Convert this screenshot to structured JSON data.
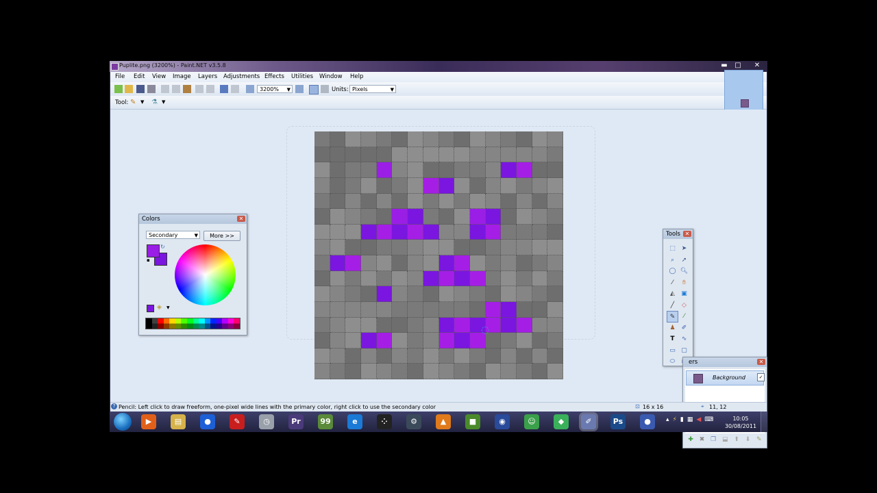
{
  "window": {
    "title": "Puplite.png (3200%) - Paint.NET v3.5.8",
    "controls": {
      "minimize": "▬",
      "maximize": "□",
      "close": "✕"
    }
  },
  "menu": [
    "File",
    "Edit",
    "View",
    "Image",
    "Layers",
    "Adjustments",
    "Effects",
    "Utilities",
    "Window",
    "Help"
  ],
  "toolbar": {
    "zoom_value": "3200%",
    "units_label": "Units:",
    "units_value": "Pixels",
    "tool_label": "Tool:"
  },
  "colors_window": {
    "title": "Colors",
    "mode": "Secondary",
    "more_button": "More >>",
    "primary_color": "#9a1ee6",
    "secondary_color": "#7a16e0",
    "palette": [
      "#000000",
      "#404040",
      "#ff0000",
      "#ff6a00",
      "#ffd800",
      "#b6ff00",
      "#4cff00",
      "#00ff21",
      "#00ff90",
      "#00ffff",
      "#0094ff",
      "#0026ff",
      "#4800ff",
      "#b200ff",
      "#ff00dc",
      "#ff006e"
    ]
  },
  "tools_window": {
    "title": "Tools"
  },
  "layers_window": {
    "title": "ers",
    "layers": [
      {
        "name": "Background",
        "checked": "✓"
      }
    ]
  },
  "canvas": {
    "size": 16,
    "base_colors": [
      "#7a7a7a",
      "#858585",
      "#8e8e8e",
      "#6e6e6e"
    ],
    "purple_pixels": [
      {
        "c": 4,
        "r": 2,
        "color": "#9a1ee6"
      },
      {
        "c": 12,
        "r": 2,
        "color": "#7a16e0"
      },
      {
        "c": 13,
        "r": 2,
        "color": "#a51ee6"
      },
      {
        "c": 7,
        "r": 3,
        "color": "#a51ee6"
      },
      {
        "c": 8,
        "r": 3,
        "color": "#7a16e0"
      },
      {
        "c": 5,
        "r": 5,
        "color": "#9a1ee6"
      },
      {
        "c": 6,
        "r": 5,
        "color": "#7a16e0"
      },
      {
        "c": 10,
        "r": 5,
        "color": "#9a1ee6"
      },
      {
        "c": 11,
        "r": 5,
        "color": "#7a16e0"
      },
      {
        "c": 3,
        "r": 6,
        "color": "#7a16e0"
      },
      {
        "c": 4,
        "r": 6,
        "color": "#a51ee6"
      },
      {
        "c": 5,
        "r": 6,
        "color": "#7a16e0"
      },
      {
        "c": 6,
        "r": 6,
        "color": "#a51ee6"
      },
      {
        "c": 7,
        "r": 6,
        "color": "#7a16e0"
      },
      {
        "c": 10,
        "r": 6,
        "color": "#7a16e0"
      },
      {
        "c": 11,
        "r": 6,
        "color": "#a51ee6"
      },
      {
        "c": 1,
        "r": 8,
        "color": "#7a16e0"
      },
      {
        "c": 2,
        "r": 8,
        "color": "#a51ee6"
      },
      {
        "c": 8,
        "r": 8,
        "color": "#7a16e0"
      },
      {
        "c": 9,
        "r": 8,
        "color": "#a51ee6"
      },
      {
        "c": 7,
        "r": 9,
        "color": "#7a16e0"
      },
      {
        "c": 8,
        "r": 9,
        "color": "#a51ee6"
      },
      {
        "c": 9,
        "r": 9,
        "color": "#7a16e0"
      },
      {
        "c": 10,
        "r": 9,
        "color": "#a51ee6"
      },
      {
        "c": 4,
        "r": 10,
        "color": "#7a16e0"
      },
      {
        "c": 11,
        "r": 11,
        "color": "#a51ee6"
      },
      {
        "c": 12,
        "r": 11,
        "color": "#7a16e0"
      },
      {
        "c": 8,
        "r": 12,
        "color": "#7a16e0"
      },
      {
        "c": 9,
        "r": 12,
        "color": "#a51ee6"
      },
      {
        "c": 10,
        "r": 12,
        "color": "#7a16e0"
      },
      {
        "c": 11,
        "r": 12,
        "color": "#a51ee6"
      },
      {
        "c": 12,
        "r": 12,
        "color": "#7a16e0"
      },
      {
        "c": 13,
        "r": 12,
        "color": "#a51ee6"
      },
      {
        "c": 3,
        "r": 13,
        "color": "#7a16e0"
      },
      {
        "c": 4,
        "r": 13,
        "color": "#a51ee6"
      },
      {
        "c": 8,
        "r": 13,
        "color": "#a51ee6"
      },
      {
        "c": 9,
        "r": 13,
        "color": "#7a16e0"
      },
      {
        "c": 10,
        "r": 13,
        "color": "#a51ee6"
      }
    ]
  },
  "status": {
    "hint": "Pencil: Left click to draw freeform, one-pixel wide lines with the primary color, right click to use the secondary color",
    "image_size": "16 x 16",
    "cursor_pos": "11, 12"
  },
  "taskbar": {
    "time": "10:05",
    "date": "30/08/2011",
    "icons": [
      {
        "name": "media-player-icon",
        "glyph": "▶",
        "color": "#e0601a"
      },
      {
        "name": "file-explorer-icon",
        "glyph": "▤",
        "color": "#d6b24a"
      },
      {
        "name": "app-blue-icon",
        "glyph": "●",
        "color": "#1d5fd6"
      },
      {
        "name": "pin-icon",
        "glyph": "✎",
        "color": "#c81e1e"
      },
      {
        "name": "clock-icon",
        "glyph": "◷",
        "color": "#9aa0aa"
      },
      {
        "name": "premiere-icon",
        "glyph": "Pr",
        "color": "#4a3a7a"
      },
      {
        "name": "app-99-icon",
        "glyph": "99",
        "color": "#5a8a3a"
      },
      {
        "name": "internet-explorer-icon",
        "glyph": "e",
        "color": "#1a7ad6"
      },
      {
        "name": "blackberry-icon",
        "glyph": "⁘",
        "color": "#222222"
      },
      {
        "name": "steam-icon",
        "glyph": "⚙",
        "color": "#3a4a5a"
      },
      {
        "name": "vlc-icon",
        "glyph": "▲",
        "color": "#e07a1a"
      },
      {
        "name": "minecraft-icon",
        "glyph": "■",
        "color": "#4a8a2a"
      },
      {
        "name": "globe-icon",
        "glyph": "◉",
        "color": "#2a4a9a"
      },
      {
        "name": "people-icon",
        "glyph": "☺",
        "color": "#3aa04a"
      },
      {
        "name": "sims-icon",
        "glyph": "◆",
        "color": "#3ab05a"
      },
      {
        "name": "paintnet-icon",
        "glyph": "✐",
        "color": "#6a7ab0"
      },
      {
        "name": "photoshop-icon",
        "glyph": "Ps",
        "color": "#1a4a8a"
      },
      {
        "name": "sphere-icon",
        "glyph": "●",
        "color": "#3a5ab0"
      }
    ]
  }
}
